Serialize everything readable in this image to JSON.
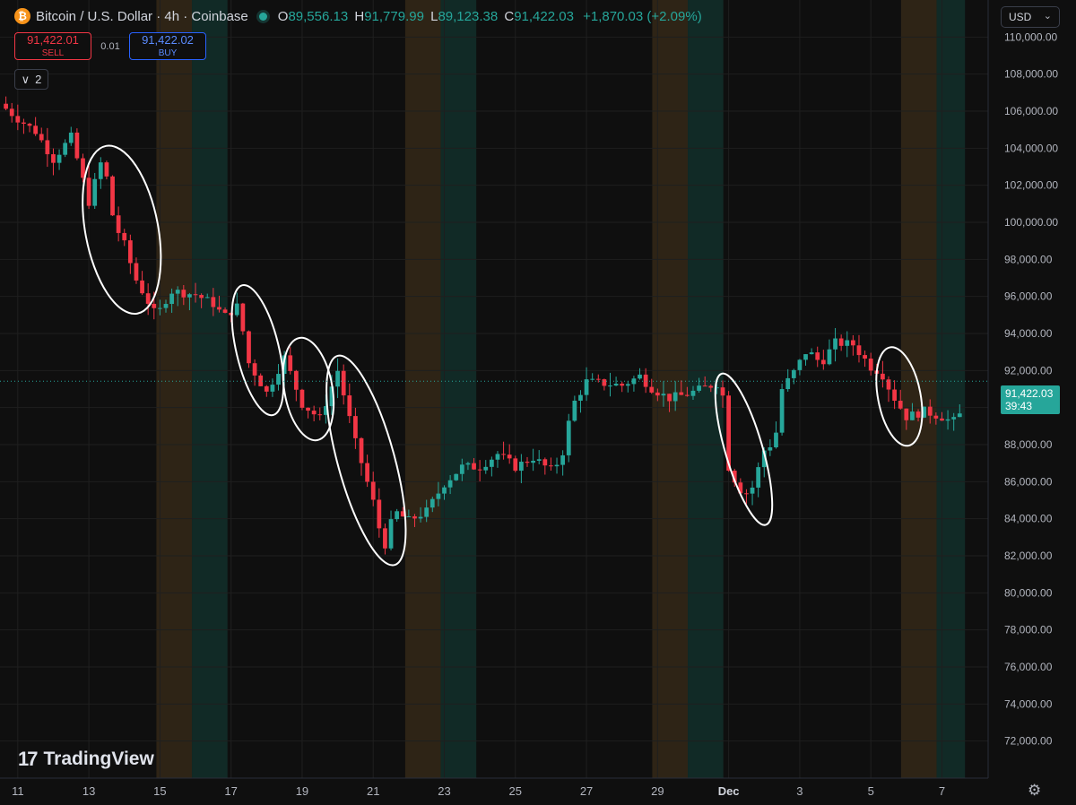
{
  "header": {
    "icon_glyph": "₿",
    "title": "Bitcoin / U.S. Dollar · 4h · Coinbase",
    "ohlc": {
      "o_label": "O",
      "o": "89,556.13",
      "h_label": "H",
      "h": "91,779.99",
      "l_label": "L",
      "l": "89,123.38",
      "c_label": "C",
      "c": "91,422.03",
      "change": "+1,870.03 (+2.09%)"
    }
  },
  "trade": {
    "sell_price": "91,422.01",
    "sell_label": "SELL",
    "spread": "0.01",
    "buy_price": "91,422.02",
    "buy_label": "BUY"
  },
  "indicators_toggle": {
    "glyph": "∨",
    "count": "2"
  },
  "currency": {
    "label": "USD",
    "chevron": "⌄"
  },
  "last_price": {
    "value": "91,422.03",
    "countdown": "39:43"
  },
  "brand": {
    "mark": "17",
    "name": "TradingView"
  },
  "settings_icon_glyph": "⚙",
  "colors": {
    "up": "#26a69a",
    "down": "#f23645",
    "background": "#0f0f0f",
    "asia_session": "#2e2416",
    "us_session": "#112a26",
    "text": "#d1d4dc"
  },
  "chart_data": {
    "type": "candlestick",
    "timeframe": "4h",
    "ylim": [
      70000,
      112000
    ],
    "yticks": [
      72000,
      74000,
      76000,
      78000,
      80000,
      82000,
      84000,
      86000,
      88000,
      90000,
      92000,
      94000,
      96000,
      98000,
      100000,
      102000,
      104000,
      106000,
      108000,
      110000
    ],
    "ytick_labels": [
      "72,000.00",
      "74,000.00",
      "76,000.00",
      "78,000.00",
      "80,000.00",
      "82,000.00",
      "84,000.00",
      "86,000.00",
      "88,000.00",
      "90,000.00",
      "92,000.00",
      "94,000.00",
      "96,000.00",
      "98,000.00",
      "100,000.00",
      "102,000.00",
      "104,000.00",
      "106,000.00",
      "108,000.00",
      "110,000.00"
    ],
    "xlim": [
      10.5,
      38.3
    ],
    "xticks": [
      11,
      13,
      15,
      17,
      19,
      21,
      23,
      25,
      27,
      29,
      31,
      33,
      35,
      37
    ],
    "xtick_labels": [
      "11",
      "13",
      "15",
      "17",
      "19",
      "21",
      "23",
      "25",
      "27",
      "29",
      "Dec",
      "3",
      "5",
      "7"
    ],
    "last_price": 91422.03,
    "shaded_periods": [
      {
        "start": 14.9,
        "end": 15.9,
        "kind": "asia"
      },
      {
        "start": 15.9,
        "end": 16.9,
        "kind": "us"
      },
      {
        "start": 21.9,
        "end": 22.9,
        "kind": "asia"
      },
      {
        "start": 22.9,
        "end": 23.9,
        "kind": "us"
      },
      {
        "start": 28.85,
        "end": 29.85,
        "kind": "asia"
      },
      {
        "start": 29.85,
        "end": 30.85,
        "kind": "us"
      },
      {
        "start": 35.85,
        "end": 36.85,
        "kind": "asia"
      },
      {
        "start": 36.85,
        "end": 37.65,
        "kind": "us"
      }
    ],
    "price_path": [
      [
        10.5,
        106400
      ],
      [
        11.0,
        105600
      ],
      [
        11.5,
        104900
      ],
      [
        12.0,
        103400
      ],
      [
        12.5,
        104600
      ],
      [
        13.0,
        101100
      ],
      [
        13.4,
        103600
      ],
      [
        13.7,
        100000
      ],
      [
        14.0,
        98800
      ],
      [
        14.3,
        97000
      ],
      [
        14.7,
        95600
      ],
      [
        14.9,
        94900
      ],
      [
        15.3,
        96300
      ],
      [
        16.0,
        96100
      ],
      [
        16.5,
        95600
      ],
      [
        16.8,
        94900
      ],
      [
        17.2,
        95500
      ],
      [
        17.5,
        92400
      ],
      [
        18.0,
        90800
      ],
      [
        18.5,
        92700
      ],
      [
        19.0,
        90200
      ],
      [
        19.5,
        89400
      ],
      [
        20.0,
        92000
      ],
      [
        20.5,
        88100
      ],
      [
        21.0,
        84900
      ],
      [
        21.3,
        82400
      ],
      [
        21.6,
        84400
      ],
      [
        22.0,
        83900
      ],
      [
        22.5,
        84400
      ],
      [
        23.0,
        85900
      ],
      [
        23.5,
        86800
      ],
      [
        24.0,
        86800
      ],
      [
        24.5,
        87500
      ],
      [
        25.0,
        86800
      ],
      [
        25.5,
        87300
      ],
      [
        26.0,
        86600
      ],
      [
        26.3,
        87300
      ],
      [
        26.6,
        90100
      ],
      [
        27.0,
        91400
      ],
      [
        27.5,
        91300
      ],
      [
        28.0,
        91200
      ],
      [
        28.5,
        91700
      ],
      [
        28.8,
        91100
      ],
      [
        29.3,
        90500
      ],
      [
        29.8,
        90700
      ],
      [
        30.5,
        91200
      ],
      [
        30.8,
        91400
      ],
      [
        31.0,
        86800
      ],
      [
        31.3,
        85600
      ],
      [
        31.6,
        85300
      ],
      [
        32.0,
        87700
      ],
      [
        32.3,
        88200
      ],
      [
        32.5,
        91000
      ],
      [
        32.8,
        91800
      ],
      [
        33.2,
        93100
      ],
      [
        33.6,
        92400
      ],
      [
        34.0,
        93500
      ],
      [
        34.5,
        93400
      ],
      [
        35.0,
        92200
      ],
      [
        35.3,
        91900
      ],
      [
        35.6,
        90700
      ],
      [
        36.0,
        89500
      ],
      [
        36.5,
        89800
      ],
      [
        37.0,
        89500
      ],
      [
        37.3,
        89200
      ],
      [
        37.5,
        89600
      ],
      [
        37.65,
        91422
      ]
    ],
    "annotations": [
      {
        "type": "ellipse",
        "x_range": [
          12.9,
          14.95
        ],
        "y_range": [
          95000,
          104200
        ]
      },
      {
        "type": "ellipse",
        "x_range": [
          17.15,
          18.35
        ],
        "y_range": [
          89500,
          96700
        ]
      },
      {
        "type": "ellipse",
        "x_range": [
          18.5,
          19.85
        ],
        "y_range": [
          88200,
          93800
        ]
      },
      {
        "type": "ellipse",
        "x_range": [
          20.0,
          21.6
        ],
        "y_range": [
          81300,
          93000
        ]
      },
      {
        "type": "ellipse",
        "x_range": [
          30.9,
          31.95
        ],
        "y_range": [
          83500,
          92000
        ]
      },
      {
        "type": "ellipse",
        "x_range": [
          35.2,
          36.4
        ],
        "y_range": [
          87900,
          93300
        ]
      }
    ]
  }
}
